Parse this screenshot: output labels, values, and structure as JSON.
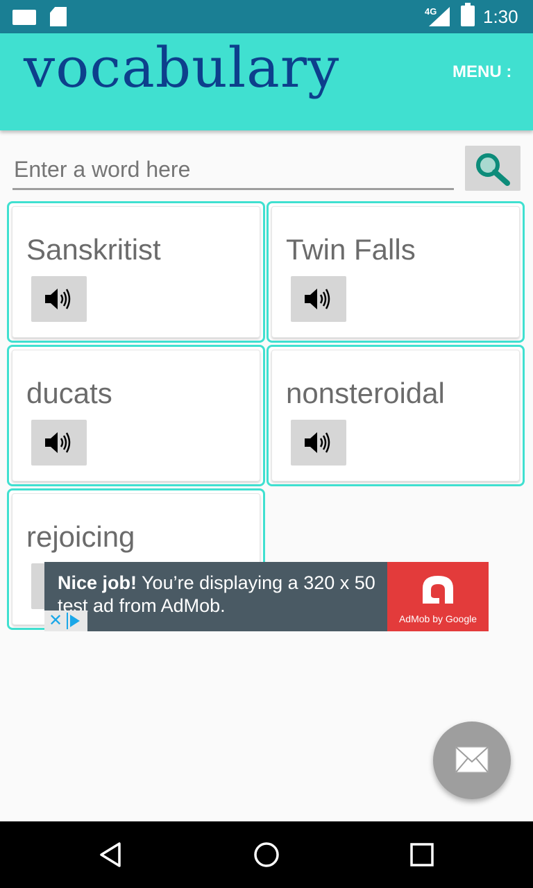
{
  "status_bar": {
    "network_label": "4G",
    "time": "1:30"
  },
  "app_bar": {
    "title": "vocabulary",
    "menu_label": "MENU :"
  },
  "search": {
    "placeholder": "Enter a word here",
    "value": ""
  },
  "cards": [
    {
      "word": "Sanskritist"
    },
    {
      "word": "Twin Falls"
    },
    {
      "word": "ducats"
    },
    {
      "word": "nonsteroidal"
    },
    {
      "word": "rejoicing"
    }
  ],
  "ad": {
    "bold_text": "Nice job!",
    "text": " You’re displaying a 320 x 50 test ad from AdMob.",
    "brand": "AdMob by Google"
  },
  "colors": {
    "status_bar": "#1a7f94",
    "app_bar": "#40e0d0",
    "title": "#0d3f8c",
    "card_border": "#40e0d0",
    "ad_background": "#4a5a64",
    "ad_logo_background": "#e33b3b",
    "fab": "#9e9e9e"
  },
  "icons": {
    "search": "magnifier-icon",
    "speaker": "speaker-icon",
    "fab": "mail-icon",
    "nav": [
      "back-icon",
      "home-icon",
      "recents-icon"
    ]
  }
}
